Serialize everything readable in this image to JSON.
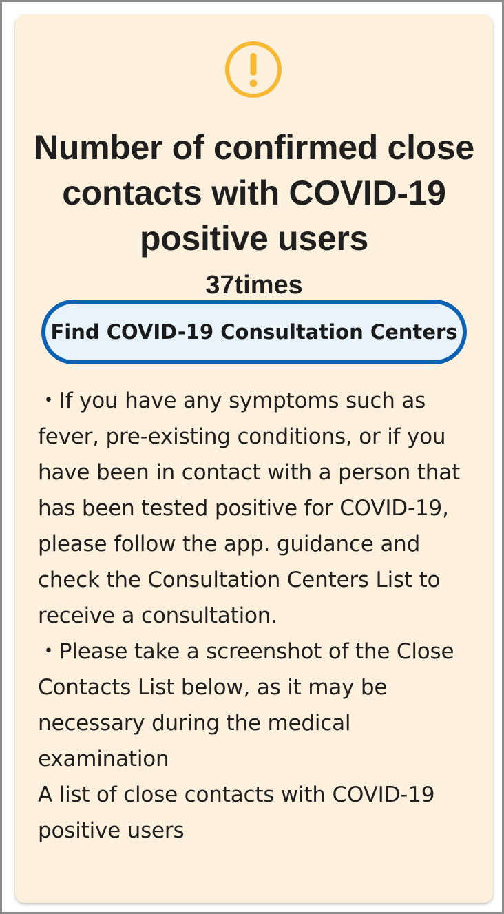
{
  "card": {
    "icon": "warning-exclamation-icon",
    "icon_color": "#f7b933",
    "title": "Number of confirmed close contacts with COVID-19 positive users",
    "count": "37times",
    "find_button_label": "Find COVID-19 Consultation Centers",
    "button_border_color": "#0d61b2",
    "paragraphs": [
      "・If you have any symptoms such as fever, pre-existing conditions, or if you have been in contact with a person that has been tested positive for COVID-19,",
      "please follow the app. guidance and check the Consultation Centers List to receive a consultation.",
      "・Please take a screenshot of the Close Contacts List below, as it may be necessary during the medical examination",
      "A list of close contacts with COVID-19 positive users"
    ]
  }
}
